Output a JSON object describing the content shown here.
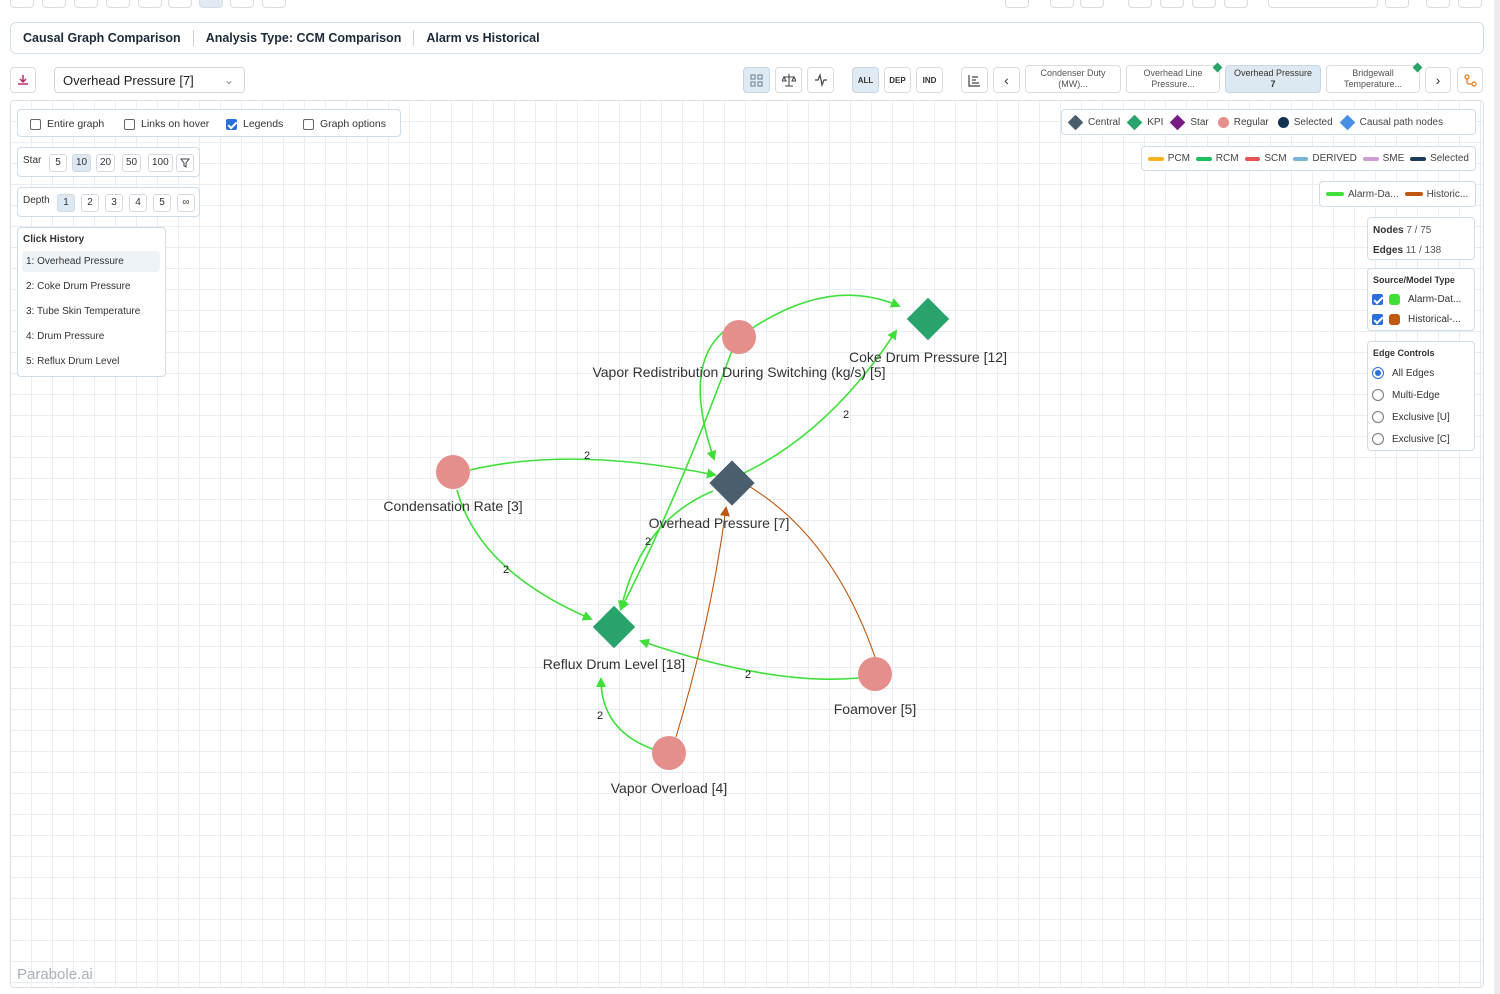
{
  "header": {
    "title": "Causal Graph Comparison",
    "analysis": "Analysis Type: CCM Comparison",
    "mode": "Alarm vs Historical"
  },
  "toolbar": {
    "target_select": "Overhead Pressure [7]",
    "filter_all": "ALL",
    "filter_dep": "DEP",
    "filter_ind": "IND",
    "node_tabs": [
      {
        "label": "Condenser Duty (MW)...",
        "sub": ""
      },
      {
        "label": "Overhead Line Pressure...",
        "sub": ""
      },
      {
        "label": "Overhead Pressure",
        "sub": "7"
      },
      {
        "label": "Bridgewall Temperature...",
        "sub": ""
      }
    ]
  },
  "options": {
    "entire_graph": "Entire graph",
    "links_on_hover": "Links on hover",
    "legends": "Legends",
    "graph_options": "Graph options",
    "star_label": "Star",
    "star_values": [
      "5",
      "10",
      "20",
      "50",
      "100"
    ],
    "depth_label": "Depth",
    "depth_values": [
      "1",
      "2",
      "3",
      "4",
      "5",
      "∞"
    ]
  },
  "click_history": {
    "title": "Click History",
    "items": [
      "1: Overhead Pressure",
      "2: Coke Drum Pressure",
      "3: Tube Skin Temperature",
      "4: Drum Pressure",
      "5: Reflux Drum Level"
    ]
  },
  "legend_nodes": [
    {
      "label": "Central",
      "color": "#4a5e6d",
      "shape": "diamond"
    },
    {
      "label": "KPI",
      "color": "#27a36b",
      "shape": "diamond"
    },
    {
      "label": "Star",
      "color": "#7a1a86",
      "shape": "diamond"
    },
    {
      "label": "Regular",
      "color": "#e48f8c",
      "shape": "circle"
    },
    {
      "label": "Selected",
      "color": "#0f3350",
      "shape": "circle"
    },
    {
      "label": "Causal path nodes",
      "color": "#4a8fe6",
      "shape": "diamond"
    }
  ],
  "legend_edges": [
    {
      "label": "PCM",
      "color": "#f5b41d"
    },
    {
      "label": "RCM",
      "color": "#1fbf5f"
    },
    {
      "label": "SCM",
      "color": "#e85454"
    },
    {
      "label": "DERIVED",
      "color": "#79b3d6"
    },
    {
      "label": "SME",
      "color": "#c9a0d0"
    },
    {
      "label": "Selected",
      "color": "#1b3a5c"
    }
  ],
  "legend_sources": [
    {
      "label": "Alarm-Da...",
      "color": "#3fe03a"
    },
    {
      "label": "Historic...",
      "color": "#c0570f"
    }
  ],
  "stats": {
    "nodes_label": "Nodes",
    "nodes_value": "7 / 75",
    "edges_label": "Edges",
    "edges_value": "11 / 138"
  },
  "source_model": {
    "title": "Source/Model Type",
    "items": [
      {
        "label": "Alarm-Dat...",
        "color": "#3fe03a"
      },
      {
        "label": "Historical-...",
        "color": "#c0570f"
      }
    ]
  },
  "edge_controls": {
    "title": "Edge Controls",
    "items": [
      "All Edges",
      "Multi-Edge",
      "Exclusive [U]",
      "Exclusive [C]"
    ],
    "selected": "All Edges"
  },
  "graph": {
    "nodes": [
      {
        "id": "op",
        "label": "Overhead Pressure [7]",
        "kind": "central"
      },
      {
        "id": "cdp",
        "label": "Coke Drum Pressure [12]",
        "kind": "kpi"
      },
      {
        "id": "rdl",
        "label": "Reflux Drum Level [18]",
        "kind": "kpi"
      },
      {
        "id": "vr",
        "label": "Vapor Redistribution During Switching (kg/s) [5]",
        "kind": "regular"
      },
      {
        "id": "cr",
        "label": "Condensation Rate [3]",
        "kind": "regular"
      },
      {
        "id": "fm",
        "label": "Foamover [5]",
        "kind": "regular"
      },
      {
        "id": "vo",
        "label": "Vapor Overload [4]",
        "kind": "regular"
      }
    ],
    "edge_labels": [
      "2",
      "2",
      "2",
      "2",
      "2",
      "2"
    ]
  },
  "brand": "Parabole.ai"
}
